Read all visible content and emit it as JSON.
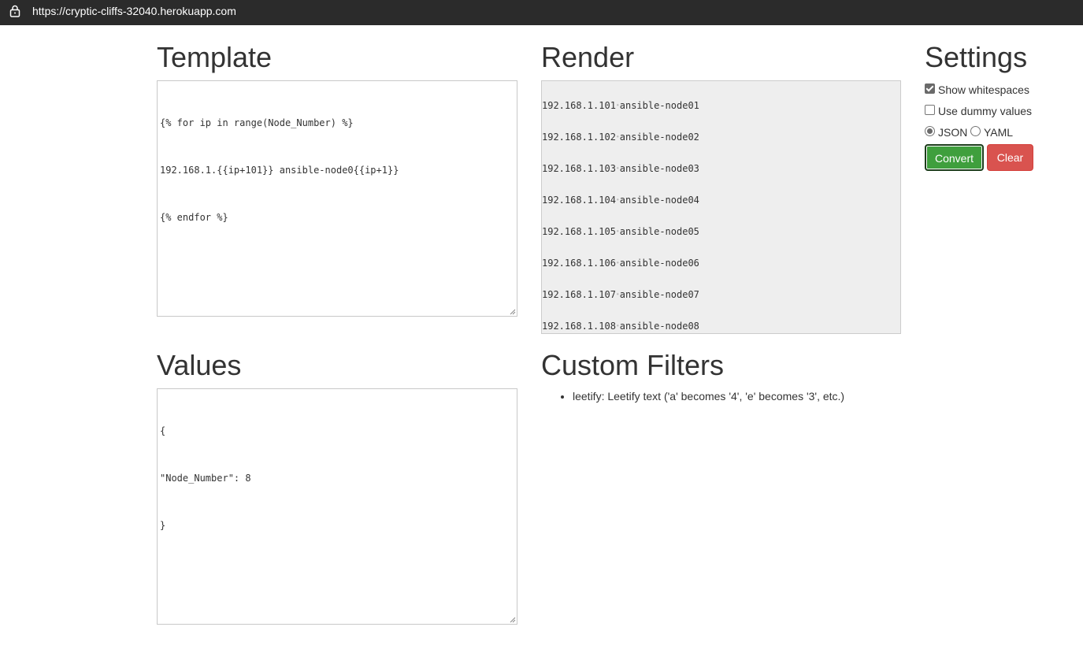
{
  "browser": {
    "url": "https://cryptic-cliffs-32040.herokuapp.com"
  },
  "headings": {
    "template": "Template",
    "render": "Render",
    "settings": "Settings",
    "values": "Values",
    "custom_filters": "Custom Filters"
  },
  "template_editor": {
    "lines": [
      "{% for ip in range(Node_Number) %}",
      "192.168.1.{{ip+101}} ansible-node0{{ip+1}}",
      "{% endfor %}"
    ]
  },
  "values_editor": {
    "lines": [
      "{",
      "\"Node_Number\": 8",
      "}"
    ]
  },
  "render_output": {
    "lines": [
      {
        "ip": "192.168.1.101",
        "host": "ansible-node01"
      },
      {
        "ip": "192.168.1.102",
        "host": "ansible-node02"
      },
      {
        "ip": "192.168.1.103",
        "host": "ansible-node03"
      },
      {
        "ip": "192.168.1.104",
        "host": "ansible-node04"
      },
      {
        "ip": "192.168.1.105",
        "host": "ansible-node05"
      },
      {
        "ip": "192.168.1.106",
        "host": "ansible-node06"
      },
      {
        "ip": "192.168.1.107",
        "host": "ansible-node07"
      },
      {
        "ip": "192.168.1.108",
        "host": "ansible-node08"
      }
    ],
    "whitespace_marker": "•"
  },
  "settings": {
    "show_whitespaces": {
      "label": "Show whitespaces",
      "checked": true
    },
    "use_dummy_values": {
      "label": "Use dummy values",
      "checked": false
    },
    "format_options": [
      {
        "label": "JSON",
        "selected": true
      },
      {
        "label": "YAML",
        "selected": false
      }
    ],
    "convert_label": "Convert",
    "clear_label": "Clear"
  },
  "custom_filters": [
    "leetify: Leetify text ('a' becomes '4', 'e' becomes '3', etc.)"
  ],
  "colors": {
    "convert_button": "#3f9f3d",
    "clear_button": "#d9534f",
    "render_background": "#eeeeee",
    "url_bar": "#2b2b2b"
  }
}
